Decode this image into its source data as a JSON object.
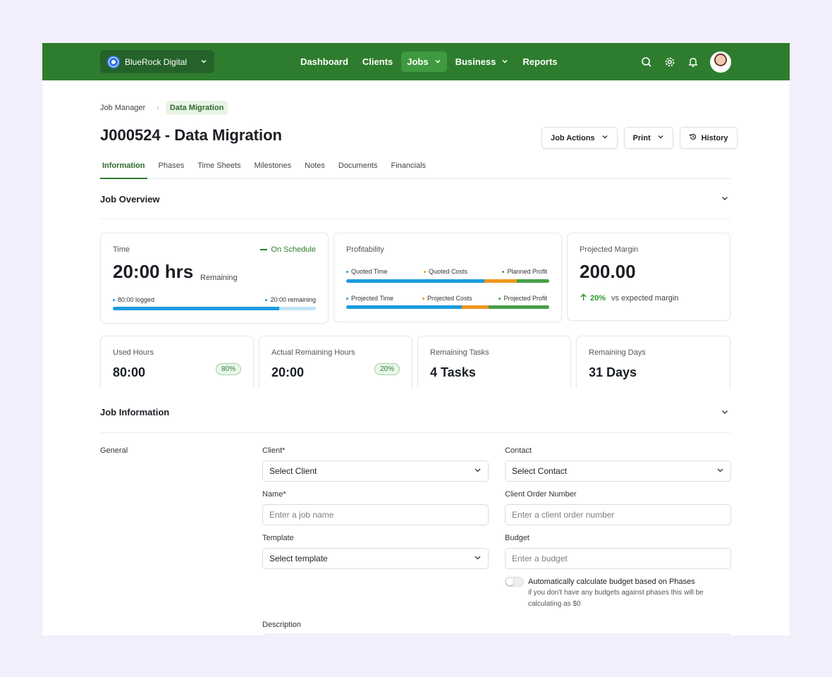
{
  "org": {
    "name": "BlueRock Digital"
  },
  "nav": {
    "items": [
      "Dashboard",
      "Clients",
      "Jobs",
      "Business",
      "Reports"
    ]
  },
  "breadcrumb": {
    "parent": "Job Manager",
    "current": "Data Migration"
  },
  "page": {
    "title": "J000524 - Data Migration"
  },
  "actions": {
    "job_actions": "Job Actions",
    "print": "Print",
    "history": "History"
  },
  "tabs": [
    "Information",
    "Phases",
    "Time Sheets",
    "Milestones",
    "Notes",
    "Documents",
    "Financials"
  ],
  "overview": {
    "heading": "Job Overview",
    "time": {
      "label": "Time",
      "status": "On Schedule",
      "value": "20:00 hrs",
      "sub": "Remaining",
      "logged": "80:00 logged",
      "remaining": "20:00 remaining",
      "progress": 0.82
    },
    "profitability": {
      "label": "Profitability",
      "row1": {
        "a": "Quoted Time",
        "b": "Quoted Costs",
        "c": "Planned Profit",
        "split": [
          0.68,
          0.16,
          0.16
        ]
      },
      "row2": {
        "a": "Projected Time",
        "b": "Projected Costs",
        "c": "Projected Profit",
        "split": [
          0.57,
          0.13,
          0.3
        ]
      }
    },
    "margin": {
      "label": "Projected Margin",
      "value": "200.00",
      "pct": "20%",
      "note": "vs expected margin"
    },
    "used_hours": {
      "label": "Used Hours",
      "value": "80:00",
      "badge": "80%"
    },
    "actual_remaining": {
      "label": "Actual Remaining Hours",
      "value": "20:00",
      "badge": "20%"
    },
    "remaining_tasks": {
      "label": "Remaining Tasks",
      "value": "4 Tasks"
    },
    "remaining_days": {
      "label": "Remaining Days",
      "value": "31 Days"
    }
  },
  "info": {
    "heading": "Job Information",
    "section": "General",
    "client": {
      "label": "Client*",
      "value": "Select Client"
    },
    "contact": {
      "label": "Contact",
      "value": "Select Contact"
    },
    "name": {
      "label": "Name*",
      "placeholder": "Enter a job name"
    },
    "order": {
      "label": "Client Order Number",
      "placeholder": "Enter a client order number"
    },
    "template": {
      "label": "Template",
      "value": "Select template"
    },
    "budget": {
      "label": "Budget",
      "placeholder": "Enter a budget"
    },
    "auto": {
      "title": "Automatically calculate budget based on Phases",
      "note1": "if you don't have any budgets against phases this will be",
      "note2": "calculating as $0",
      "on": false
    },
    "description": {
      "label": "Description"
    }
  },
  "colors": {
    "brand": "#2e7d2e",
    "blue": "#1a9be0",
    "orange": "#f0951f",
    "green": "#46a046",
    "light_blue": "#bfe4f7"
  }
}
